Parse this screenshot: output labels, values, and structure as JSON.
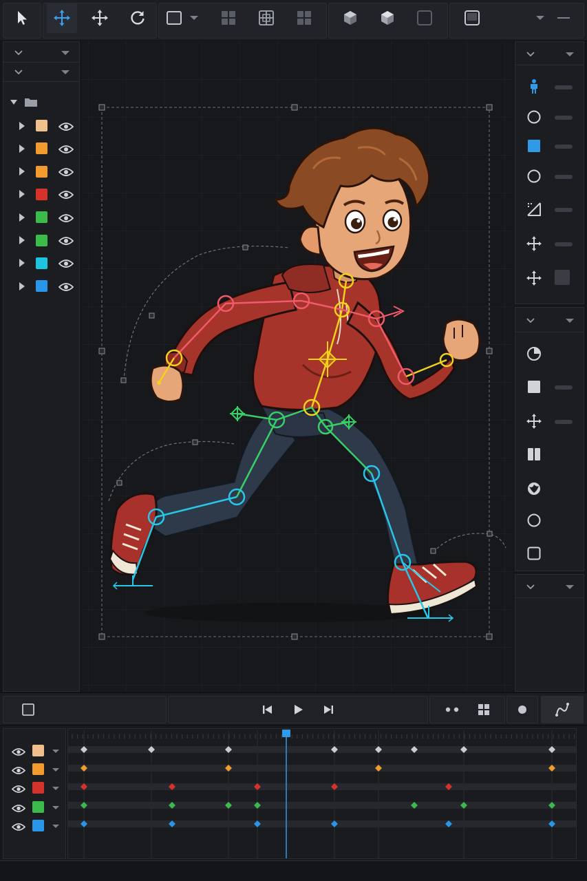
{
  "toolbar": {
    "tools": [
      {
        "name": "select-tool",
        "active": false
      },
      {
        "name": "move-tool",
        "active": true
      },
      {
        "name": "transform-tool",
        "active": false
      },
      {
        "name": "rotate-tool",
        "active": false
      },
      {
        "name": "rectangle-tool",
        "active": false
      },
      {
        "name": "grid-view-1",
        "active": false
      },
      {
        "name": "grid-view-2",
        "active": false
      },
      {
        "name": "grid-view-3",
        "active": false
      },
      {
        "name": "cube-wire",
        "active": false
      },
      {
        "name": "cube-solid",
        "active": false
      },
      {
        "name": "rounded-frame",
        "active": false
      },
      {
        "name": "frame-view",
        "active": false
      }
    ]
  },
  "layers": {
    "items": [
      {
        "color": "#f0c08c"
      },
      {
        "color": "#f39a2e"
      },
      {
        "color": "#f39a2e"
      },
      {
        "color": "#d5322b"
      },
      {
        "color": "#3dbb4a"
      },
      {
        "color": "#3dbb4a"
      },
      {
        "color": "#1ec3df"
      },
      {
        "color": "#2996ea"
      }
    ]
  },
  "right_panel": {
    "icons": [
      "figure-icon",
      "circle-icon",
      "square-blue-icon",
      "circle-icon",
      "scale-icon",
      "move-icon",
      "move-icon"
    ],
    "icons2": [
      "pie-icon",
      "square-fill-icon",
      "move-icon",
      "columns-icon",
      "sphere-icon",
      "circle-icon",
      "rounded-square-icon"
    ]
  },
  "timeline": {
    "tracks": [
      {
        "color": "#f0c08c"
      },
      {
        "color": "#f39a2e"
      },
      {
        "color": "#d5322b"
      },
      {
        "color": "#3dbb4a"
      },
      {
        "color": "#2996ea"
      }
    ],
    "playhead_frame": 0.43
  },
  "colors": {
    "accent": "#2f9be8",
    "yellow_bone": "#f2d21b",
    "red_bone": "#f15a6a",
    "green_bone": "#39cf66",
    "cyan_bone": "#27c7e9"
  }
}
